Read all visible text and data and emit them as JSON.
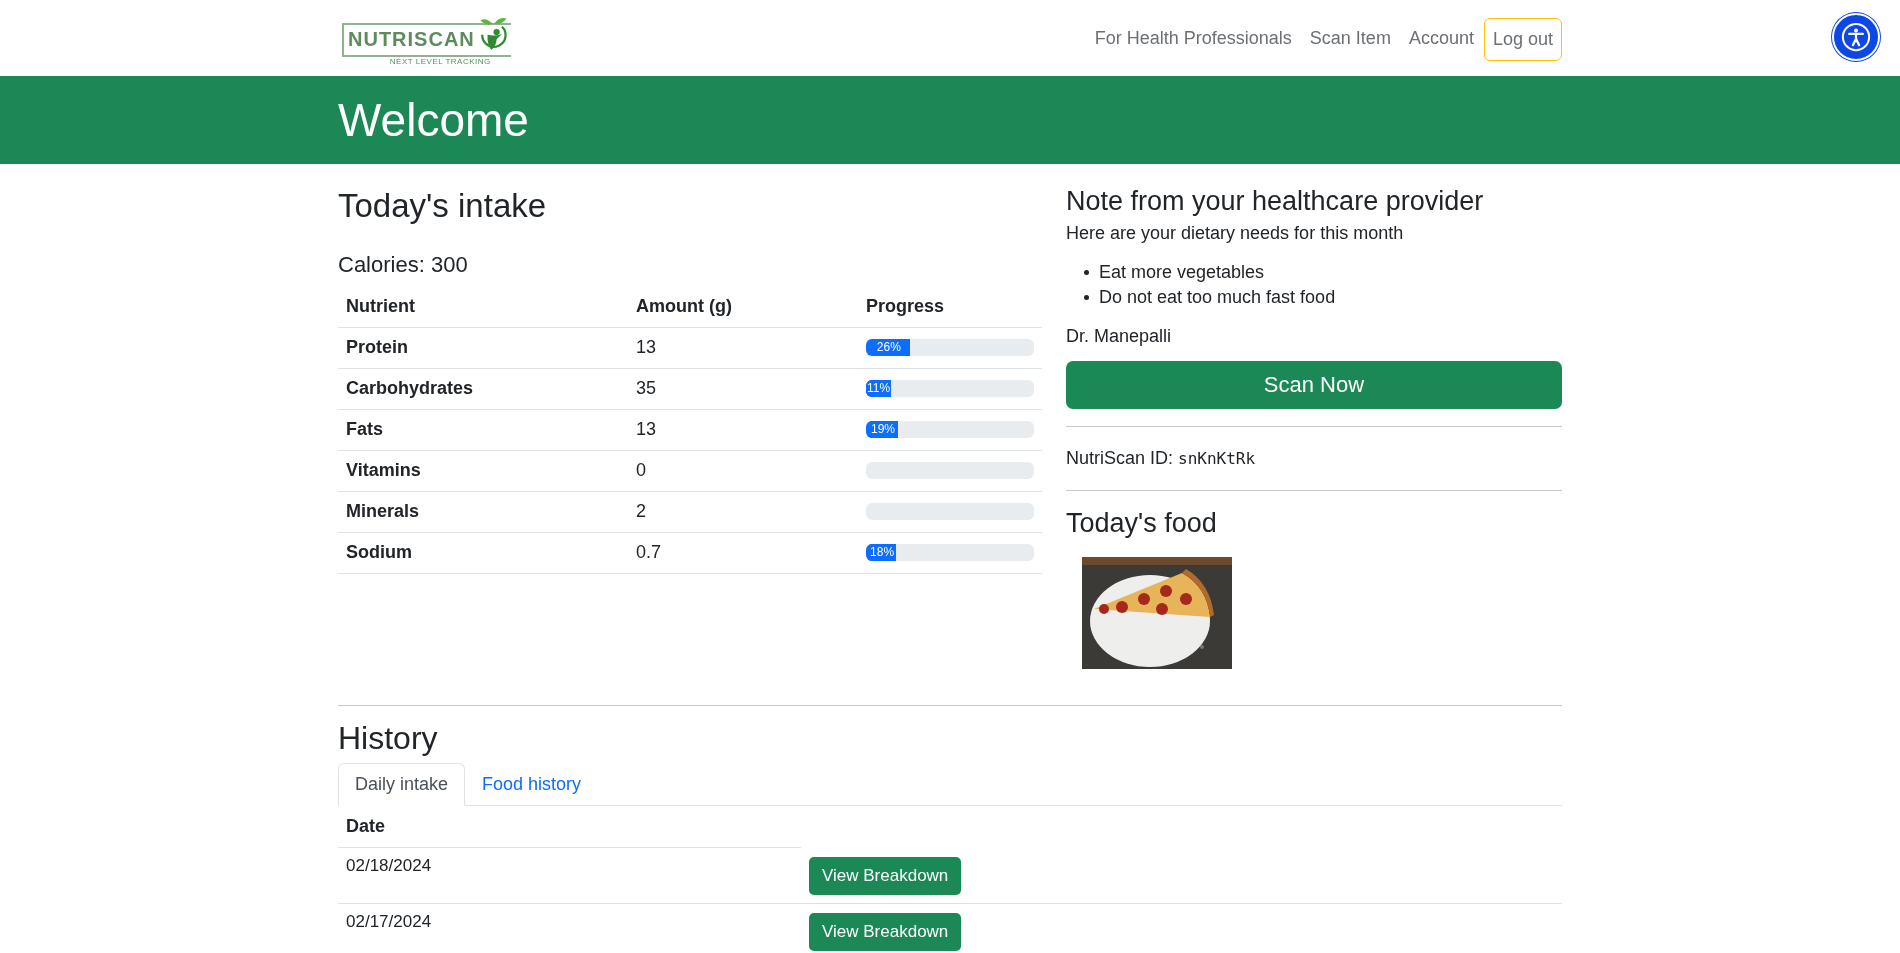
{
  "header": {
    "logo": {
      "name": "NUTRISCAN",
      "tagline": "NEXT LEVEL TRACKING"
    },
    "nav": [
      {
        "label": "For Health Professionals",
        "kind": "link"
      },
      {
        "label": "Scan Item",
        "kind": "link"
      },
      {
        "label": "Account",
        "kind": "link"
      },
      {
        "label": "Log out",
        "kind": "outlined"
      }
    ]
  },
  "banner": {
    "title": "Welcome"
  },
  "intake": {
    "title": "Today's intake",
    "calories": "Calories: 300",
    "columns": [
      "Nutrient",
      "Amount (g)",
      "Progress"
    ],
    "rows": [
      {
        "nutrient": "Protein",
        "amount": "13",
        "level": 0.26,
        "reading": "26%"
      },
      {
        "nutrient": "Carbohydrates",
        "amount": "35",
        "level": 0.11,
        "reading": "11%"
      },
      {
        "nutrient": "Fats",
        "amount": "13",
        "level": 0.19,
        "reading": "19%"
      },
      {
        "nutrient": "Vitamins",
        "amount": "0"
      },
      {
        "nutrient": "Minerals",
        "amount": "2"
      },
      {
        "nutrient": "Sodium",
        "amount": "0.7",
        "level": 0.18,
        "reading": "18%"
      }
    ]
  },
  "note": {
    "title": "Note from your healthcare provider",
    "intro": "Here are your dietary needs for this month",
    "items": [
      "Eat more vegetables",
      "Do not eat too much fast food"
    ],
    "signature": "Dr. Manepalli"
  },
  "scan_button": "Scan Now",
  "nutriscan_id": {
    "label": "NutriScan ID:",
    "value": "snKnKtRk"
  },
  "food": {
    "title": "Today's food"
  },
  "history": {
    "title": "History",
    "tabs": [
      {
        "label": "Daily intake",
        "selected": true
      },
      {
        "label": "Food history",
        "selected": false
      }
    ],
    "column": "Date",
    "rows": [
      {
        "date": "02/18/2024",
        "action": "View Breakdown"
      },
      {
        "date": "02/17/2024",
        "action": "View Breakdown"
      }
    ]
  }
}
